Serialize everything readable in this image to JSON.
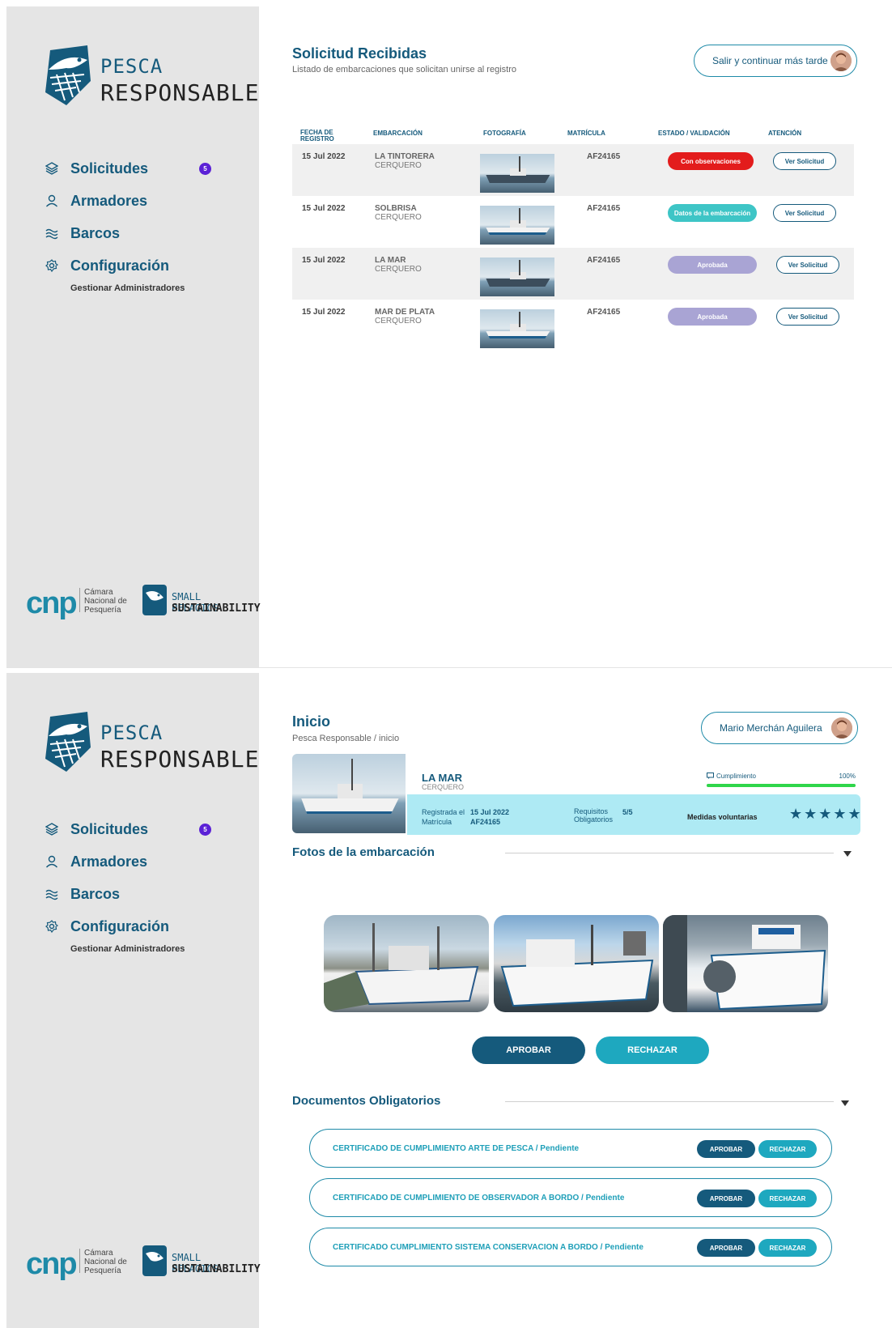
{
  "brand": {
    "line1": "PESCA",
    "line2": "RESPONSABLE"
  },
  "nav": {
    "items": [
      {
        "label": "Solicitudes",
        "icon": "layers-icon",
        "badge": "5"
      },
      {
        "label": "Armadores",
        "icon": "user-icon"
      },
      {
        "label": "Barcos",
        "icon": "waves-icon"
      },
      {
        "label": "Configuración",
        "icon": "gear-icon"
      }
    ],
    "sub_item": "Gestionar Administradores"
  },
  "partners": {
    "cnp_logo": "cnp",
    "cnp_line1": "Cámara",
    "cnp_line2": "Nacional de",
    "cnp_line3": "Pesquería",
    "sps_line1": "SMALL PELAGICS",
    "sps_line2": "SUSTAINABILITY"
  },
  "screen1": {
    "title": "Solicitud Recibidas",
    "subtitle": "Listado de embarcaciones que solicitan unirse al registro",
    "user_button": "Salir y continuar más tarde",
    "columns": [
      "FECHA DE REGISTRO",
      "EMBARCACIÓN",
      "FOTOGRAFÍA",
      "MATRÍCULA",
      "ESTADO / VALIDACIÓN",
      "ATENCIÓN"
    ],
    "col_date_1": "FECHA DE",
    "col_date_2": "REGISTRO",
    "rows": [
      {
        "date": "15 Jul 2022",
        "name": "LA TINTORERA",
        "type": "CERQUERO",
        "matricula": "AF24165",
        "status": "Con observaciones",
        "status_color": "#e31c1c",
        "action": "Ver Solicitud"
      },
      {
        "date": "15 Jul 2022",
        "name": "SOLBRISA",
        "type": "CERQUERO",
        "matricula": "AF24165",
        "status": "Datos de la embarcación",
        "status_color": "#3ec5c6",
        "action": "Ver Solicitud"
      },
      {
        "date": "15 Jul 2022",
        "name": "LA MAR",
        "type": "CERQUERO",
        "matricula": "AF24165",
        "status": "Aprobada",
        "status_color": "#a9a4d4",
        "action": "Ver Solicitud"
      },
      {
        "date": "15 Jul 2022",
        "name": "MAR DE PLATA",
        "type": "CERQUERO",
        "matricula": "AF24165",
        "status": "Aprobada",
        "status_color": "#a9a4d4",
        "action": "Ver Solicitud"
      }
    ]
  },
  "screen2": {
    "title": "Inicio",
    "breadcrumb": "Pesca Responsable / inicio",
    "user_button": "Mario Merchán Aguilera",
    "boat": {
      "name": "LA MAR",
      "type": "CERQUERO",
      "registered_label": "Registrada el",
      "registered_value": "15 Jul 2022",
      "matricula_label": "Matrícula",
      "matricula_value": "AF24165",
      "req_label_1": "Requisitos",
      "req_label_2": "Obligatorios",
      "req_value": "5/5",
      "voluntary_label": "Medidas voluntarias",
      "stars": "★★★★★",
      "stars_rating": 5,
      "compliance_label": "Cumplimiento",
      "compliance_value": "100%",
      "compliance_fraction": 1.0
    },
    "photos_title": "Fotos de la embarcación",
    "approve": "APROBAR",
    "reject": "RECHAZAR",
    "docs_title": "Documentos Obligatorios",
    "docs": [
      {
        "label": "CERTIFICADO DE CUMPLIMIENTO ARTE DE PESCA / Pendiente",
        "approve": "APROBAR",
        "reject": "RECHAZAR"
      },
      {
        "label": "CERTIFICADO DE CUMPLIMIENTO DE OBSERVADOR A BORDO / Pendiente",
        "approve": "APROBAR",
        "reject": "RECHAZAR"
      },
      {
        "label": "CERTIFICADO CUMPLIMIENTO SISTEMA CONSERVACION A BORDO / Pendiente",
        "approve": "APROBAR",
        "reject": "RECHAZAR"
      }
    ]
  },
  "colors": {
    "primary": "#155a7c",
    "teal": "#1e9fb8",
    "badge": "#5b21d6",
    "sidebar": "#e5e5e5",
    "band": "#aeeaf4",
    "progress": "#2fd64a"
  }
}
